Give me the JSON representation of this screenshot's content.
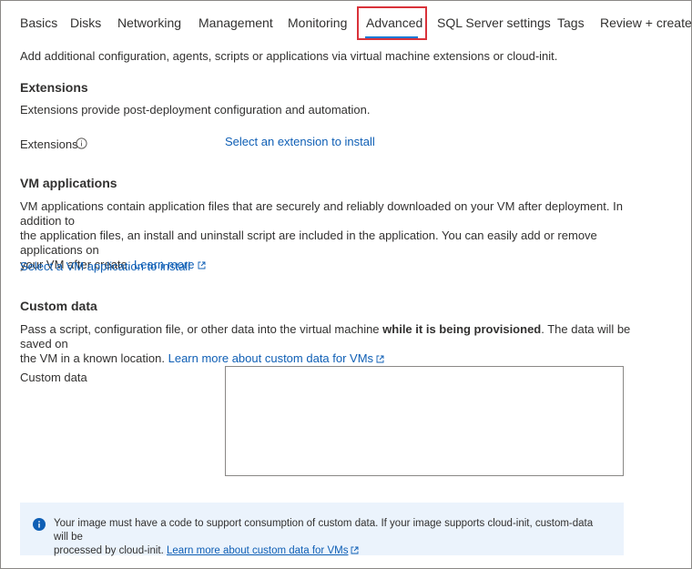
{
  "tabs": [
    {
      "label": "Basics"
    },
    {
      "label": "Disks"
    },
    {
      "label": "Networking"
    },
    {
      "label": "Management"
    },
    {
      "label": "Monitoring"
    },
    {
      "label": "Advanced"
    },
    {
      "label": "SQL Server settings"
    },
    {
      "label": "Tags"
    },
    {
      "label": "Review + create"
    }
  ],
  "active_tab": "Advanced",
  "intro": "Add additional configuration, agents, scripts or applications via virtual machine extensions or cloud-init.",
  "extensions": {
    "heading": "Extensions",
    "description": "Extensions provide post-deployment configuration and automation.",
    "field_label": "Extensions",
    "select_link": "Select an extension to install"
  },
  "vm_applications": {
    "heading": "VM applications",
    "description_1": "VM applications contain application files that are securely and reliably downloaded on your VM after deployment. In addition to",
    "description_2": "the application files, an install and uninstall script are included in the application. You can easily add or remove applications on",
    "description_3": "your VM after create.",
    "learn_more": "Learn more",
    "select_link": "Select a VM application to install"
  },
  "custom_data": {
    "heading": "Custom data",
    "description_pre": "Pass a script, configuration file, or other data into the virtual machine ",
    "description_bold": "while it is being provisioned",
    "description_post": ". The data will be saved on",
    "description_line2": "the VM in a known location.",
    "learn_more": "Learn more about custom data for VMs",
    "field_label": "Custom data",
    "field_value": ""
  },
  "info_box": {
    "text_1": "Your image must have a code to support consumption of custom data. If your image supports cloud-init, custom-data will be",
    "text_2": "processed by cloud-init.",
    "link": "Learn more about custom data for VMs"
  },
  "colors": {
    "accent": "#0078d4",
    "link": "#0f5fb5",
    "highlight_border": "#d9323a",
    "info_bg": "#ebf3fc"
  }
}
